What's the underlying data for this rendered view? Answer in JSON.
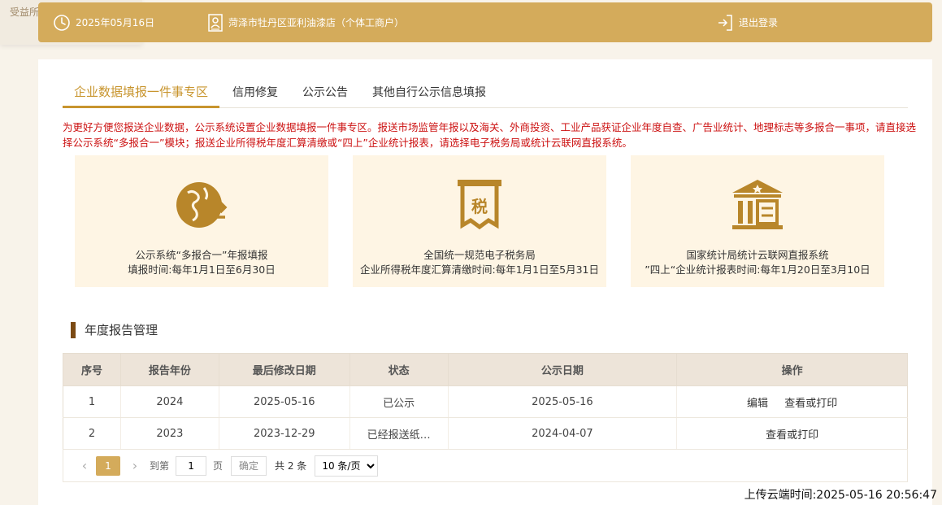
{
  "bg_fragment": "受益所",
  "topbar": {
    "date": "2025年05月16日",
    "shop": "菏泽市牡丹区亚利油漆店（个体工商户）",
    "logout": "退出登录"
  },
  "tabs": [
    {
      "label": "企业数据填报一件事专区",
      "active": true
    },
    {
      "label": "信用修复",
      "active": false
    },
    {
      "label": "公示公告",
      "active": false
    },
    {
      "label": "其他自行公示信息填报",
      "active": false
    }
  ],
  "notice": "为更好方便您报送企业数据，公示系统设置企业数据填报一件事专区。报送市场监管年报以及海关、外商投资、工业产品获证企业年度自查、广告业统计、地理标志等多报合一事项，请直接选择公示系统“多报合一”模块；报送企业所得税年度汇算清缴或“四上”企业统计报表，请选择电子税务局或统计云联网直报系统。",
  "cards": [
    {
      "icon": "globe-arrows-icon",
      "line1": "公示系统“多报合一”年报填报",
      "line2": "填报时间:每年1月1日至6月30日"
    },
    {
      "icon": "tax-receipt-icon",
      "line1": "全国统一规范电子税务局",
      "line2": "企业所得税年度汇算清缴时间:每年1月1日至5月31日"
    },
    {
      "icon": "government-building-icon",
      "line1": "国家统计局统计云联网直报系统",
      "line2": "”四上“企业统计报表时间:每年1月20日至3月10日"
    }
  ],
  "section_title": "年度报告管理",
  "table": {
    "headers": [
      "序号",
      "报告年份",
      "最后修改日期",
      "状态",
      "公示日期",
      "操作"
    ],
    "rows": [
      {
        "no": "1",
        "year": "2024",
        "modified": "2025-05-16",
        "status": "已公示",
        "published": "2025-05-16",
        "actions": [
          "编辑",
          "查看或打印"
        ]
      },
      {
        "no": "2",
        "year": "2023",
        "modified": "2023-12-29",
        "status": "已经报送纸…",
        "published": "2024-04-07",
        "actions": [
          "查看或打印"
        ]
      }
    ]
  },
  "pager": {
    "prev": "‹",
    "current": "1",
    "next": "›",
    "goto_label": "到第",
    "goto_value": "1",
    "page_unit": "页",
    "confirm": "确定",
    "total": "共 2 条",
    "page_size": "10 条/页"
  },
  "upload_time": "上传云端时间:2025-05-16 20:56:47",
  "colors": {
    "accent": "#d4ab5b",
    "tab_active": "#c8952e",
    "notice": "#cc1111",
    "card_bg": "#fef5e4",
    "icon": "#b8862a"
  }
}
